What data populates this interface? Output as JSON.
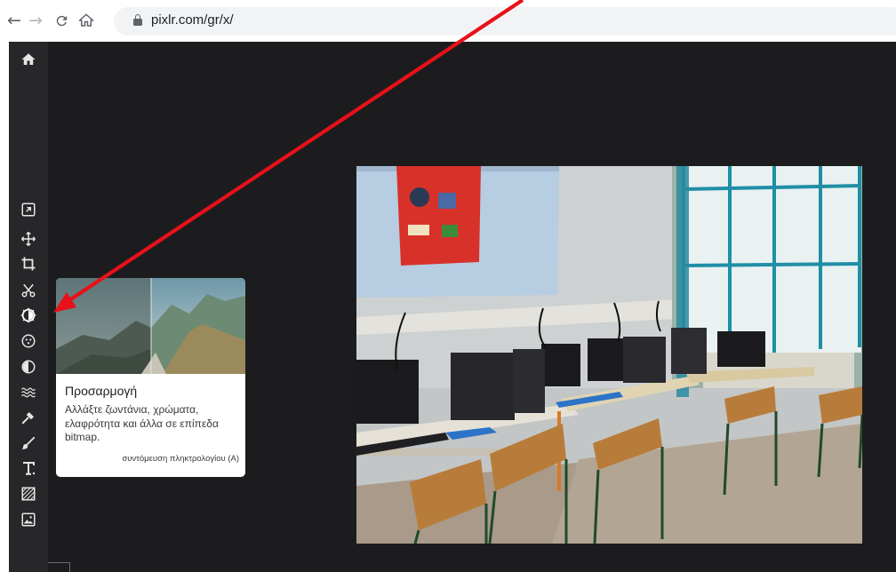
{
  "browser": {
    "url": "pixlr.com/gr/x/",
    "icons": {
      "back": "arrow-left-icon",
      "forward": "arrow-right-icon",
      "reload": "reload-icon",
      "home": "home-icon",
      "lock": "lock-icon"
    }
  },
  "toolbar": {
    "tools": [
      {
        "name": "home-icon"
      },
      {
        "name": "arrange-icon"
      },
      {
        "name": "move-icon"
      },
      {
        "name": "crop-icon"
      },
      {
        "name": "cutout-icon"
      },
      {
        "name": "adjust-icon",
        "active": true
      },
      {
        "name": "filter-icon"
      },
      {
        "name": "liquify-icon"
      },
      {
        "name": "wave-effect-icon"
      },
      {
        "name": "retouch-icon"
      },
      {
        "name": "brush-icon"
      },
      {
        "name": "text-icon"
      },
      {
        "name": "pattern-icon"
      },
      {
        "name": "add-image-icon"
      }
    ]
  },
  "tooltip": {
    "title": "Προσαρμογή",
    "description": "Αλλάξτε ζωντάνια, χρώματα, ελαφρότητα και άλλα σε επίπεδα bitmap.",
    "shortcut": "συντόμευση πληκτρολογίου (A)"
  },
  "colors": {
    "app_background": "#1c1c1e",
    "toolbar_background": "#27272a",
    "annotation_arrow": "#e8101a"
  }
}
